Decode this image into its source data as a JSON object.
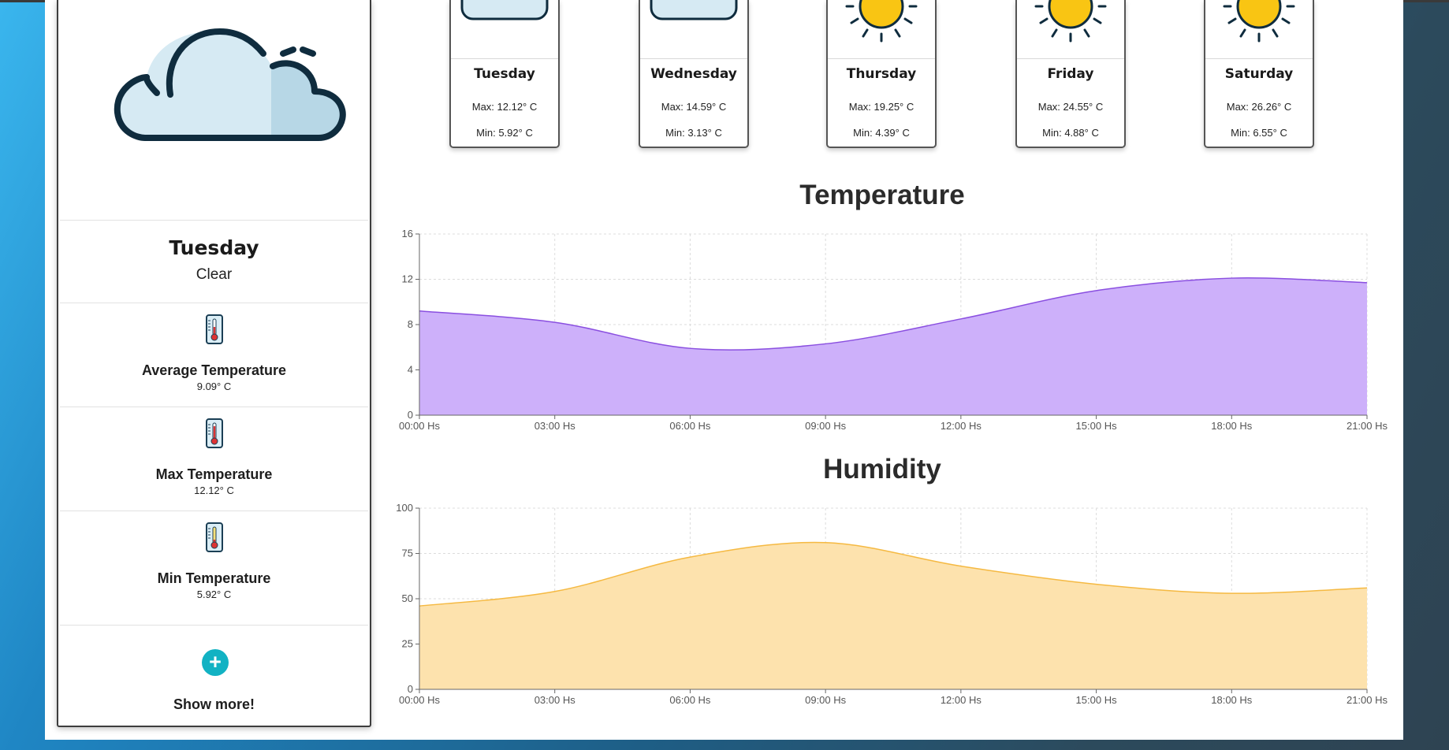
{
  "sidebar": {
    "day": "Tuesday",
    "condition": "Clear",
    "stats": [
      {
        "label": "Average Temperature",
        "value": "9.09° C"
      },
      {
        "label": "Max Temperature",
        "value": "12.12° C"
      },
      {
        "label": "Min Temperature",
        "value": "5.92° C"
      }
    ],
    "more_label": "Show more!",
    "more_icon": "+"
  },
  "forecast": [
    {
      "day": "Tuesday",
      "max": "Max: 12.12° C",
      "min": "Min: 5.92° C",
      "icon": "cloud-icon"
    },
    {
      "day": "Wednesday",
      "max": "Max: 14.59° C",
      "min": "Min: 3.13° C",
      "icon": "cloud-icon"
    },
    {
      "day": "Thursday",
      "max": "Max: 19.25° C",
      "min": "Min: 4.39° C",
      "icon": "sun-icon"
    },
    {
      "day": "Friday",
      "max": "Max: 24.55° C",
      "min": "Min: 4.88° C",
      "icon": "sun-icon"
    },
    {
      "day": "Saturday",
      "max": "Max: 26.26° C",
      "min": "Min: 6.55° C",
      "icon": "sun-icon"
    }
  ],
  "colors": {
    "temperature": "#cdb0fa",
    "temperature_line": "#8a4fe0",
    "humidity": "#fde2ad",
    "humidity_line": "#f5b942",
    "button": "#12b2c3"
  },
  "chart_data": [
    {
      "type": "area",
      "title": "Temperature",
      "x": [
        "00:00 Hs",
        "03:00 Hs",
        "06:00 Hs",
        "09:00 Hs",
        "12:00 Hs",
        "15:00 Hs",
        "18:00 Hs",
        "21:00 Hs"
      ],
      "y": [
        9.2,
        8.2,
        5.9,
        6.3,
        8.5,
        11.0,
        12.1,
        11.7
      ],
      "yticks": [
        0,
        4,
        8,
        12,
        16
      ],
      "ylim": [
        0,
        16
      ],
      "grid": true
    },
    {
      "type": "area",
      "title": "Humidity",
      "x": [
        "00:00 Hs",
        "03:00 Hs",
        "06:00 Hs",
        "09:00 Hs",
        "12:00 Hs",
        "15:00 Hs",
        "18:00 Hs",
        "21:00 Hs"
      ],
      "y": [
        46,
        54,
        73,
        81,
        68,
        58,
        53,
        56
      ],
      "yticks": [
        0,
        25,
        50,
        75,
        100
      ],
      "ylim": [
        0,
        100
      ],
      "grid": true
    }
  ]
}
